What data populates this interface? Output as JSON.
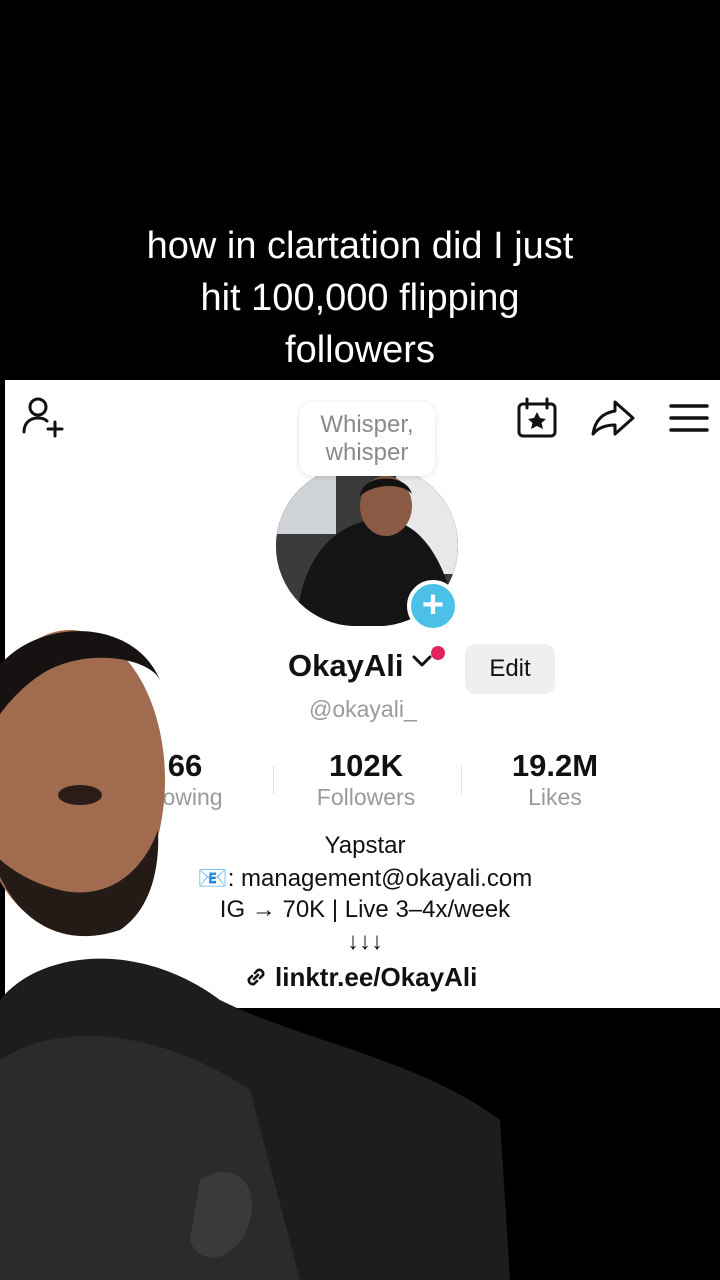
{
  "caption": {
    "line1": "how in clartation did I just",
    "line2": "hit 100,000 flipping",
    "line3": "followers"
  },
  "toolbar": {
    "add_friend_icon": "person-add-icon",
    "calendar_icon": "calendar-star-icon",
    "share_icon": "share-arrow-icon",
    "menu_icon": "hamburger-menu-icon"
  },
  "bubble": {
    "line1": "Whisper,",
    "line2": "whisper"
  },
  "profile": {
    "name": "OkayAli",
    "handle": "@okayali_",
    "edit_label": "Edit"
  },
  "stats": {
    "following_value": "66",
    "following_label": "lowing",
    "followers_value": "102K",
    "followers_label": "Followers",
    "likes_value": "19.2M",
    "likes_label": "Likes"
  },
  "bio": {
    "line1": "Yapstar",
    "line2_icon": "📧",
    "line2": ": management@okayali.com",
    "line3": "IG → 70K | Live 3–4x/week",
    "line4": "↓↓↓",
    "link": "linktr.ee/OkayAli"
  },
  "colors": {
    "background": "#000000",
    "panel": "#ffffff",
    "accent_blue": "#4cc1e8",
    "notification_red": "#e0245e",
    "muted_text": "#9a9a9a"
  }
}
